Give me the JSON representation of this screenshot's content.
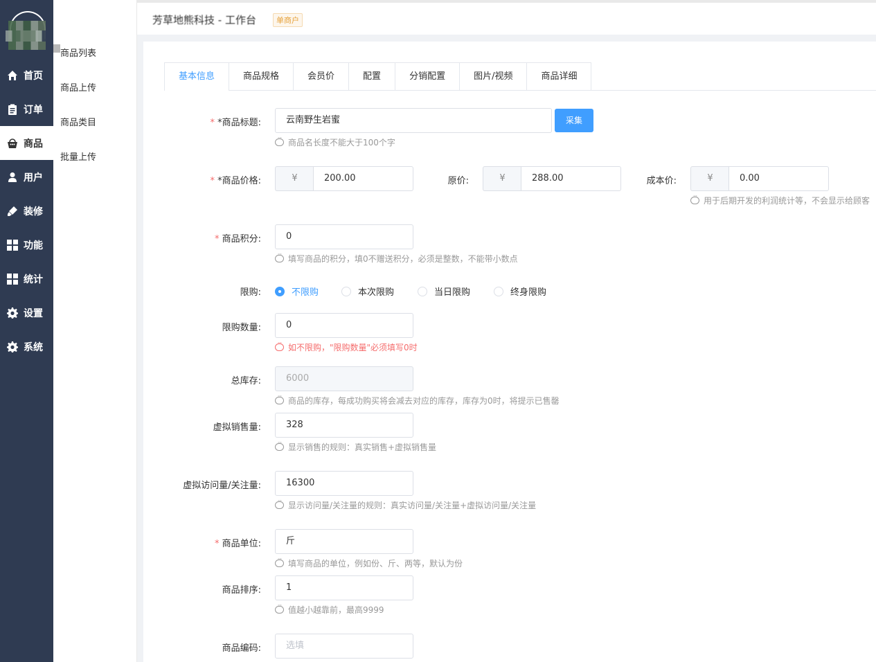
{
  "nav": {
    "items": [
      {
        "label": "首页",
        "icon": "home-icon"
      },
      {
        "label": "订单",
        "icon": "clipboard-icon"
      },
      {
        "label": "商品",
        "icon": "shopping-bag-icon"
      },
      {
        "label": "用户",
        "icon": "user-icon"
      },
      {
        "label": "装修",
        "icon": "brush-icon"
      },
      {
        "label": "功能",
        "icon": "grid-icon"
      },
      {
        "label": "统计",
        "icon": "grid-icon"
      },
      {
        "label": "设置",
        "icon": "gear-icon"
      },
      {
        "label": "系统",
        "icon": "gear-icon"
      }
    ],
    "active_index": 2
  },
  "subnav": {
    "items": [
      "商品列表",
      "商品上传",
      "商品类目",
      "批量上传"
    ]
  },
  "header": {
    "title": "芳草地熊科技 - 工作台",
    "badge": "单商户"
  },
  "tabs": [
    "基本信息",
    "商品规格",
    "会员价",
    "配置",
    "分销配置",
    "图片/视频",
    "商品详细"
  ],
  "active_tab": 0,
  "form": {
    "title": {
      "required": "*",
      "label": "*商品标题:",
      "value": "云南野生岩蜜",
      "button": "采集",
      "hint": "商品名长度不能大于100个字"
    },
    "price": {
      "required": "*",
      "label": "*商品价格:",
      "currency": "¥",
      "value": "200.00",
      "orig_label": "原价:",
      "orig_value": "288.00",
      "cost_label": "成本价:",
      "cost_value": "0.00",
      "hint": "用于后期开发的利润统计等，不会显示给顾客"
    },
    "points": {
      "required": "*",
      "label": "商品积分:",
      "value": "0",
      "hint": "填写商品的积分，填0不赠送积分，必须是整数，不能带小数点"
    },
    "limit": {
      "label": "限购:",
      "options": [
        "不限购",
        "本次限购",
        "当日限购",
        "终身限购"
      ],
      "selected": 0
    },
    "limit_qty": {
      "label": "限购数量:",
      "value": "0",
      "hint": "如不限购，\"限购数量\"必须填写0时"
    },
    "stock": {
      "label": "总库存:",
      "value": "6000",
      "hint": "商品的库存，每成功购买将会减去对应的库存，库存为0时，将提示已售罄"
    },
    "virtual_sales": {
      "label": "虚拟销售量:",
      "value": "328",
      "hint": "显示销售的规则：真实销售+虚拟销售量"
    },
    "virtual_visits": {
      "label": "虚拟访问量/关注量:",
      "value": "16300",
      "hint": "显示访问量/关注量的规则：真实访问量/关注量+虚拟访问量/关注量"
    },
    "unit": {
      "required": "*",
      "label": "商品单位:",
      "value": "斤",
      "hint": "填写商品的单位，例如份、斤、两等，默认为份"
    },
    "sort": {
      "label": "商品排序:",
      "value": "1",
      "hint": "值越小越靠前，最高9999"
    },
    "code": {
      "label": "商品编码:",
      "placeholder": "选填"
    }
  },
  "colors": {
    "nav_bg": "#2f3b52",
    "accent": "#409eff",
    "error": "#f56c6c",
    "badge": "#e6a23c"
  }
}
